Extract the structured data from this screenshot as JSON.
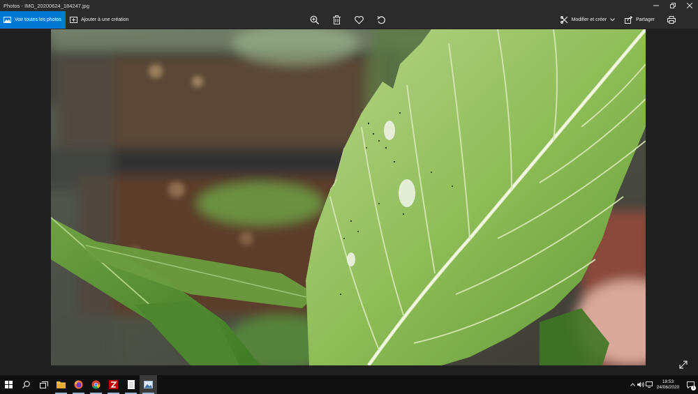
{
  "window": {
    "title": "Photos - IMG_20200624_184247.jpg",
    "controls": [
      "minimize-icon",
      "restore-icon",
      "close-icon"
    ]
  },
  "toolbar": {
    "see_all_label": "Voir toutes les photos",
    "add_to_creation_label": "Ajouter à une création",
    "center_tools": [
      "zoom-in-icon",
      "delete-icon",
      "favorite-icon",
      "rotate-icon"
    ],
    "edit_label": "Modifier et créer",
    "share_label": "Partager",
    "print_icon": "print-icon",
    "more_icon": "more-icon"
  },
  "viewer": {
    "fullscreen_icon": "fullscreen-icon"
  },
  "taskbar": {
    "apps": [
      "start-icon",
      "search-icon",
      "task-view-icon",
      "file-explorer-icon",
      "firefox-icon",
      "chrome-icon",
      "filezilla-icon",
      "notepad-icon",
      "photos-icon"
    ],
    "time": "18:53",
    "date": "24/06/2020",
    "notification_count": "1"
  },
  "colors": {
    "accent": "#0078d4",
    "chrome_bg": "#2b2b2b",
    "taskbar_bg": "#101010",
    "leaf_green": "#7fb04a"
  }
}
